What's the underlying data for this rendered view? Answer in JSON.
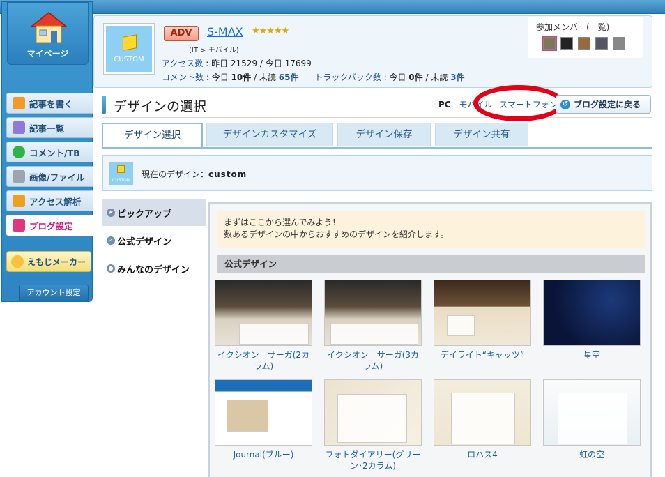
{
  "sidebar": {
    "mypage_label": "マイページ",
    "items": [
      {
        "label": "記事を書く",
        "icon": "pencil-icon"
      },
      {
        "label": "記事一覧",
        "icon": "document-icon"
      },
      {
        "label": "コメント/TB",
        "icon": "speech-bubble-icon"
      },
      {
        "label": "画像/ファイル",
        "icon": "image-icon"
      },
      {
        "label": "アクセス解析",
        "icon": "bar-chart-icon"
      },
      {
        "label": "ブログ設定",
        "icon": "wrench-icon"
      }
    ],
    "emoji_maker": "えもじメーカー",
    "account_settings": "アカウント設定"
  },
  "header": {
    "thumb_text": "CUSTOM",
    "plan_badge": "ADV",
    "blog_name": "S-MAX",
    "stars": "★★★★★",
    "category": "(IT > モバイル)",
    "access_label": "アクセス数",
    "access_value": ": 昨日 21529 / 今日 17699",
    "comment_label": "コメント数",
    "comment_value": ": 今日",
    "comment_today": "10件",
    "comment_sep": "/ 未読",
    "comment_unread": "65件",
    "trackback_label": "トラックバック数",
    "trackback_value": ": 今日",
    "trackback_today": "0件",
    "trackback_sep": "/ 未読",
    "trackback_unread": "3件",
    "members_title": "参加メンバー(一覧)"
  },
  "page": {
    "title": "デザインの選択",
    "mode_pc": "PC",
    "mode_mobile": "モバイル",
    "mode_smartphone": "スマートフォン",
    "back_button": "ブログ設定に戻る",
    "tabs": [
      "デザイン選択",
      "デザインカスタマイズ",
      "デザイン保存",
      "デザイン共有"
    ],
    "current_design_label": "現在のデザイン：",
    "current_design_value": "custom",
    "current_thumb_text": "CUSTOM"
  },
  "leftnav": [
    "ピックアップ",
    "公式デザイン",
    "みんなのデザイン"
  ],
  "content": {
    "intro_line1": "まずはここから選んでみよう！",
    "intro_line2": "数あるデザインの中からおすすめのデザインを紹介します。",
    "section_title": "公式デザイン",
    "designs": [
      "イクシオン　サーガ(2カラム)",
      "イクシオン　サーガ(3カラム)",
      "デイライト“キャッツ”",
      "星空",
      "Journal(ブルー)",
      "フォトダイアリー(グリーン･2カラム)",
      "ロハス4",
      "虹の空"
    ]
  }
}
